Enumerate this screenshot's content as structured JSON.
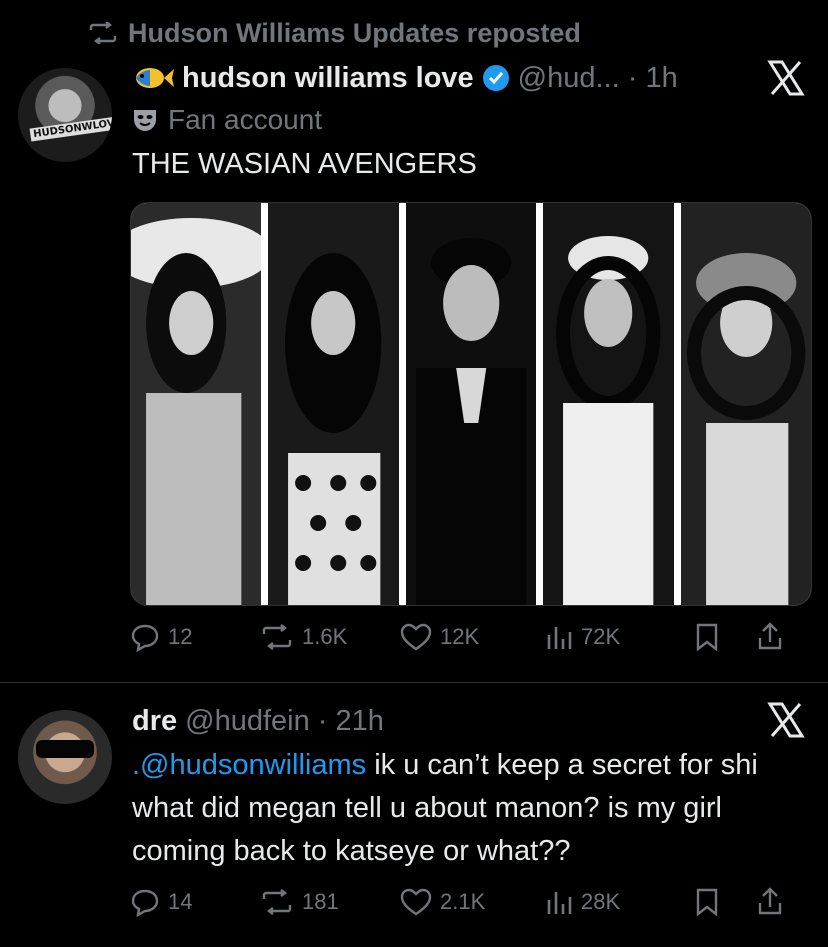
{
  "repost_header": {
    "text": "Hudson Williams Updates reposted"
  },
  "tweet1": {
    "display_name": "hudson williams love",
    "handle_time": "@hud... · 1h",
    "affiliation": "Fan account",
    "text": "THE WASIAN AVENGERS",
    "avatar_text": "HUDSONWLOVE",
    "stats": {
      "replies": "12",
      "reposts": "1.6K",
      "likes": "12K",
      "views": "72K"
    }
  },
  "tweet2": {
    "display_name": "dre",
    "handle_time": "@hudfein · 21h",
    "mention": ".@hudsonwilliams",
    "text": " ik u can’t keep a secret for shi what did megan tell u about manon? is my girl coming back to katseye or what??",
    "stats": {
      "replies": "14",
      "reposts": "181",
      "likes": "2.1K",
      "views": "28K"
    }
  },
  "colors": {
    "background": "#000000",
    "text": "#e7e9ea",
    "muted": "#71767b",
    "link": "#1d9bf0",
    "verified": "#1d9bf0"
  },
  "icons": [
    "repost-icon",
    "fish-emoji-icon",
    "verified-badge-icon",
    "x-logo-icon",
    "mask-icon",
    "reply-icon",
    "like-icon",
    "views-icon",
    "bookmark-icon",
    "share-icon"
  ]
}
